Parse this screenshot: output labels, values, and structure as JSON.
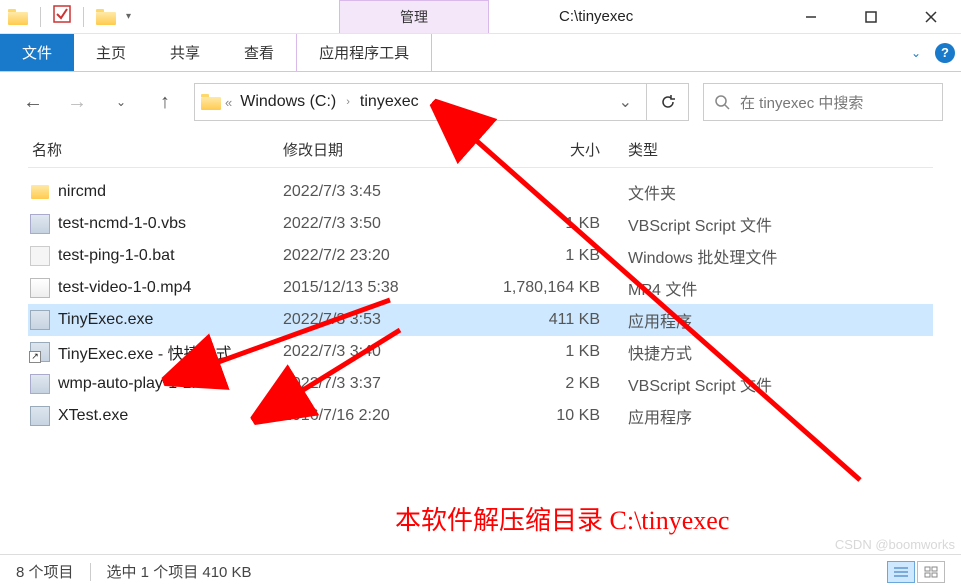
{
  "window": {
    "context_tab": "管理",
    "title": "C:\\tinyexec"
  },
  "ribbon": {
    "file": "文件",
    "home": "主页",
    "share": "共享",
    "view": "查看",
    "tools": "应用程序工具"
  },
  "breadcrumb": {
    "prefix": "«",
    "seg1": "Windows (C:)",
    "seg2": "tinyexec"
  },
  "search": {
    "placeholder": "在 tinyexec 中搜索"
  },
  "columns": {
    "name": "名称",
    "date": "修改日期",
    "size": "大小",
    "type": "类型"
  },
  "rows": [
    {
      "icon": "folder",
      "name": "nircmd",
      "date": "2022/7/3 3:45",
      "size": "",
      "type": "文件夹",
      "selected": false
    },
    {
      "icon": "vbs",
      "name": "test-ncmd-1-0.vbs",
      "date": "2022/7/3 3:50",
      "size": "1 KB",
      "type": "VBScript Script 文件",
      "selected": false
    },
    {
      "icon": "bat",
      "name": "test-ping-1-0.bat",
      "date": "2022/7/2 23:20",
      "size": "1 KB",
      "type": "Windows 批处理文件",
      "selected": false
    },
    {
      "icon": "mp4",
      "name": "test-video-1-0.mp4",
      "date": "2015/12/13 5:38",
      "size": "1,780,164 KB",
      "type": "MP4 文件",
      "selected": false
    },
    {
      "icon": "exe",
      "name": "TinyExec.exe",
      "date": "2022/7/3 3:53",
      "size": "411 KB",
      "type": "应用程序",
      "selected": true
    },
    {
      "icon": "lnk",
      "name": "TinyExec.exe - 快捷方式",
      "date": "2022/7/3 3:40",
      "size": "1 KB",
      "type": "快捷方式",
      "selected": false
    },
    {
      "icon": "vbs",
      "name": "wmp-auto-play-1-1.vbs",
      "date": "2022/7/3 3:37",
      "size": "2 KB",
      "type": "VBScript Script 文件",
      "selected": false
    },
    {
      "icon": "exe",
      "name": "XTest.exe",
      "date": "2016/7/16 2:20",
      "size": "10 KB",
      "type": "应用程序",
      "selected": false
    }
  ],
  "status": {
    "count": "8 个项目",
    "selection": "选中 1 个项目  410 KB"
  },
  "annotation": {
    "text": "本软件解压缩目录 C:\\tinyexec"
  },
  "watermark": "CSDN @boomworks"
}
